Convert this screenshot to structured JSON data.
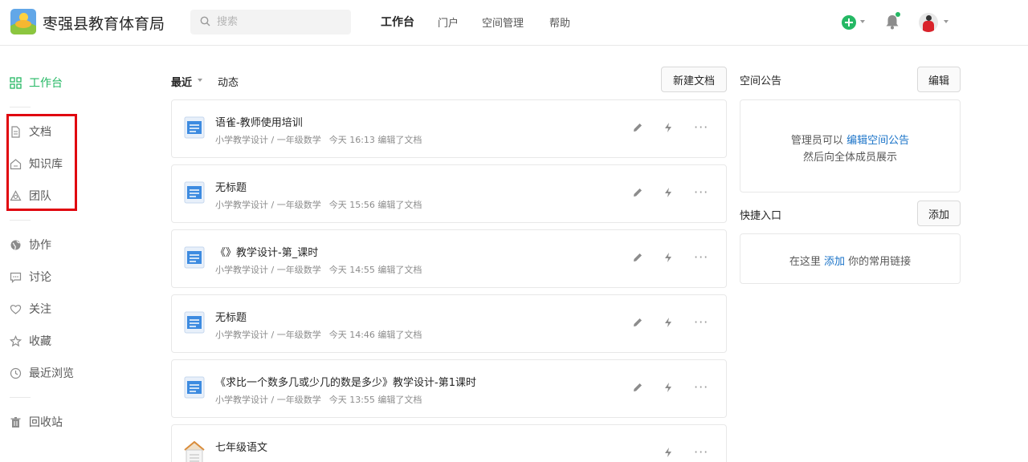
{
  "header": {
    "brand": "枣强县教育体育局",
    "search_placeholder": "搜索",
    "nav": [
      "工作台",
      "门户",
      "空间管理",
      "帮助"
    ]
  },
  "sidebar": {
    "workbench": "工作台",
    "docs": "文档",
    "knowledge": "知识库",
    "team": "团队",
    "collab": "协作",
    "discuss": "讨论",
    "follow": "关注",
    "favorites": "收藏",
    "recent": "最近浏览",
    "trash": "回收站"
  },
  "main": {
    "filter_recent": "最近",
    "filter_activity": "动态",
    "new_doc": "新建文档",
    "docs": [
      {
        "title": "语雀-教师使用培训",
        "path": "小学教学设计 / 一年级数学",
        "time": "今天 16:13 编辑了文档"
      },
      {
        "title": "无标题",
        "path": "小学教学设计 / 一年级数学",
        "time": "今天 15:56 编辑了文档"
      },
      {
        "title": "《》教学设计-第_课时",
        "path": "小学教学设计 / 一年级数学",
        "time": "今天 14:55 编辑了文档"
      },
      {
        "title": "无标题",
        "path": "小学教学设计 / 一年级数学",
        "time": "今天 14:46 编辑了文档"
      },
      {
        "title": "《求比一个数多几或少几的数是多少》教学设计-第1课时",
        "path": "小学教学设计 / 一年级数学",
        "time": "今天 13:55 编辑了文档"
      },
      {
        "title": "七年级语文",
        "path": "",
        "time": ""
      }
    ],
    "more": "···"
  },
  "right": {
    "notice_title": "空间公告",
    "notice_edit": "编辑",
    "notice_line1_prefix": "管理员可以 ",
    "notice_line1_link": "编辑空间公告",
    "notice_line2": "然后向全体成员展示",
    "quick_title": "快捷入口",
    "quick_add": "添加",
    "quick_prefix": "在这里 ",
    "quick_link": "添加",
    "quick_suffix": " 你的常用链接"
  },
  "colors": {
    "accent": "#25b864",
    "link": "#1a73c8",
    "highlight": "#e0060f"
  }
}
